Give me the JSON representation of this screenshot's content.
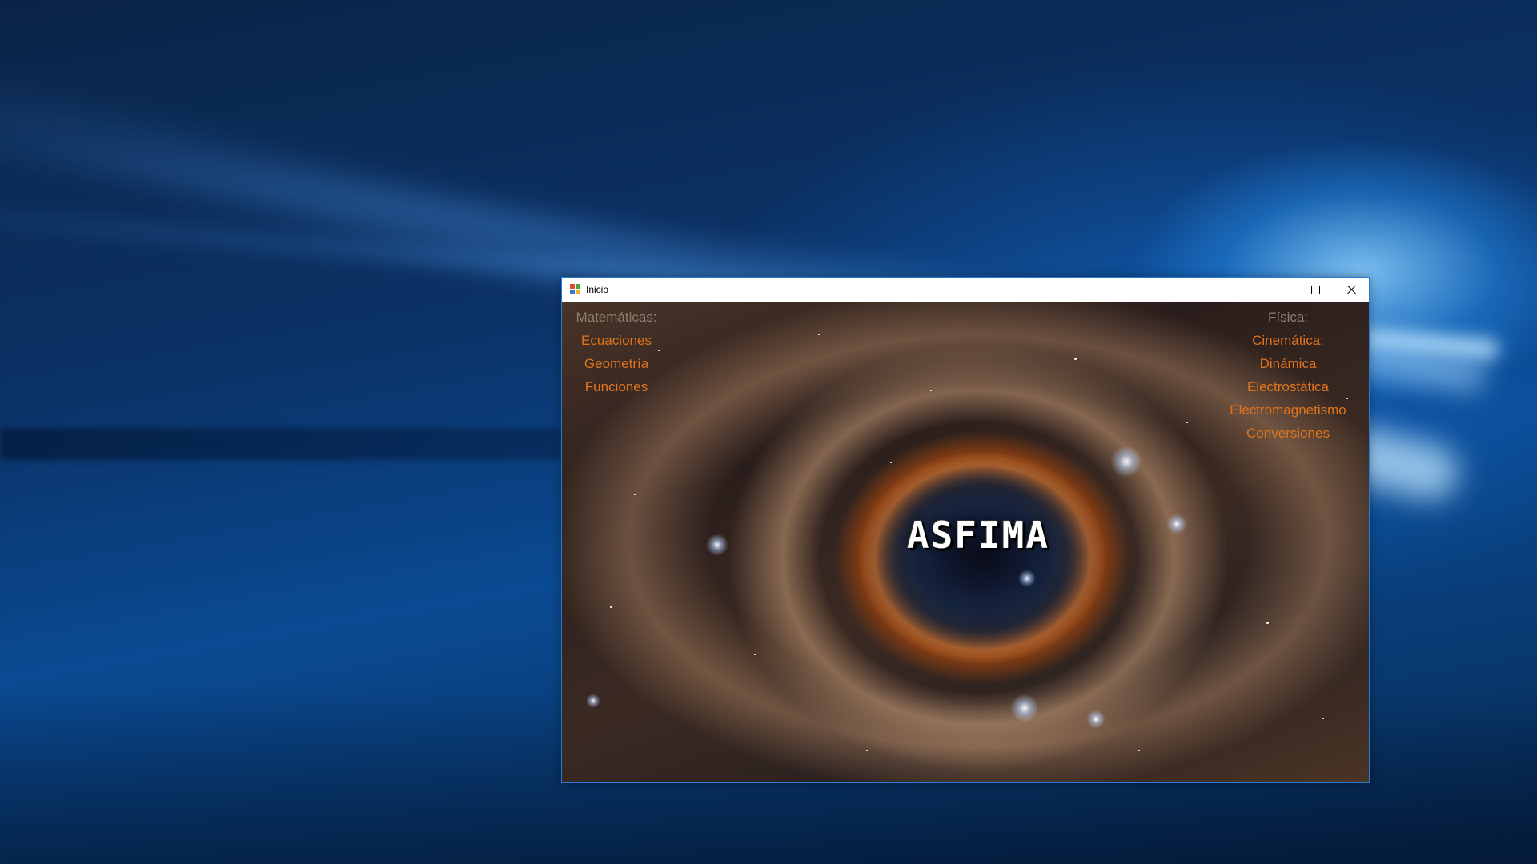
{
  "window": {
    "title": "Inicio",
    "controls": [
      "minimize",
      "maximize",
      "close"
    ]
  },
  "app": {
    "logo_text": "ASFIMA",
    "matematicas": {
      "heading": "Matemáticas:",
      "items": [
        "Ecuaciones",
        "Geometría",
        "Funciones"
      ]
    },
    "fisica": {
      "heading": "Física:",
      "items": [
        "Cinemática:",
        "Dinámica",
        "Electrostática",
        "Electromagnetismo",
        "Conversiones"
      ]
    }
  },
  "colors": {
    "menu_item": "#e0741e",
    "menu_heading": "#8a8070",
    "window_border": "#2b79d0"
  },
  "icons": {
    "app_icon": "windows-form-icon",
    "minimize": "minimize-icon",
    "maximize": "maximize-icon",
    "close": "close-icon"
  }
}
